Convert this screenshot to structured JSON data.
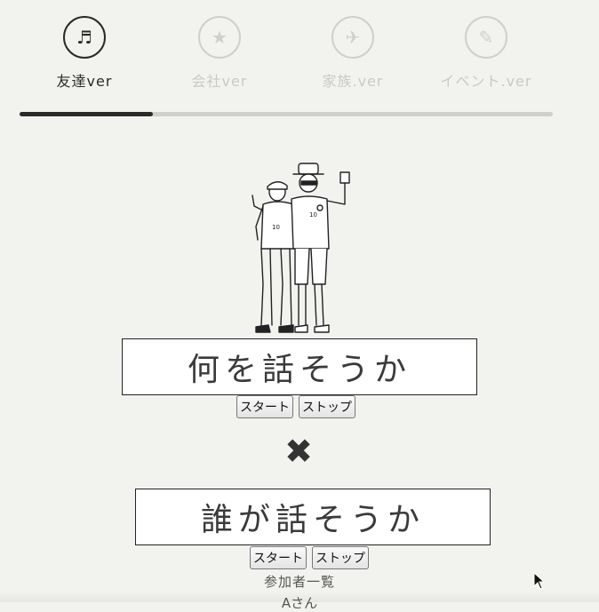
{
  "tabs": [
    {
      "label": "友達ver",
      "icon": "music-note-icon",
      "glyph": "♬",
      "active": true
    },
    {
      "label": "会社ver",
      "icon": "star-icon",
      "glyph": "★",
      "active": false
    },
    {
      "label": "家族.ver",
      "icon": "airplane-icon",
      "glyph": "✈",
      "active": false
    },
    {
      "label": "イベント.ver",
      "icon": "pencil-icon",
      "glyph": "✎",
      "active": false
    }
  ],
  "progress": {
    "value": 0.25
  },
  "topic": {
    "display": "何を話そうか",
    "start_label": "スタート",
    "stop_label": "ストップ"
  },
  "cross_glyph": "✖",
  "speaker": {
    "display": "誰が話そうか",
    "start_label": "スタート",
    "stop_label": "ストップ"
  },
  "participants": {
    "title": "参加者一覧",
    "items": [
      "Aさん"
    ]
  },
  "colors": {
    "background": "#f2f2ef",
    "active": "#2a2a2a",
    "inactive": "#cfcfcc"
  }
}
